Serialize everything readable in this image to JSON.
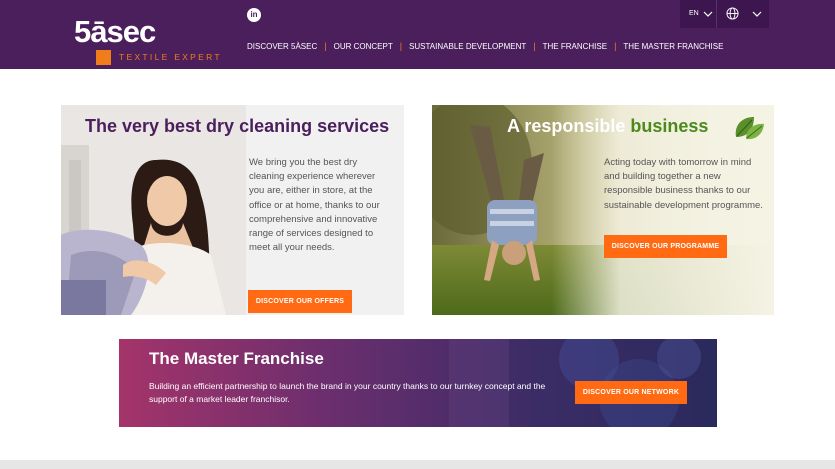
{
  "header": {
    "logo_main": "5āsec",
    "logo_sub": "TEXTILE EXPERT",
    "linkedin_icon": "linkedin-icon",
    "nav": [
      "DISCOVER 5ÀSEC",
      "OUR CONCEPT",
      "SUSTAINABLE DEVELOPMENT",
      "THE FRANCHISE",
      "THE MASTER FRANCHISE"
    ],
    "lang": "EN",
    "globe_icon": "globe-icon"
  },
  "cards": {
    "services": {
      "title": "The very best dry cleaning services",
      "text": "We bring you the best dry cleaning experience wherever you are, either in store, at the office or at home, thanks to our comprehensive and innovative range of services designed to meet all your needs.",
      "button": "DISCOVER OUR OFFERS"
    },
    "responsible": {
      "title_part1": "A responsible",
      "title_part2": "business",
      "text": "Acting today with tomorrow in mind and building together a new responsible business thanks to our sustainable development programme.",
      "button": "DISCOVER OUR PROGRAMME",
      "leaf_icon": "leaf-icon"
    }
  },
  "banner": {
    "title": "The Master Franchise",
    "text": "Building an efficient partnership to launch the brand in your country thanks to our turnkey concept and the support of a market leader franchisor.",
    "button": "DISCOVER OUR NETWORK"
  },
  "colors": {
    "header_bg": "#4a1f5c",
    "accent_orange": "#ff6a13",
    "green": "#4d8a1d"
  }
}
